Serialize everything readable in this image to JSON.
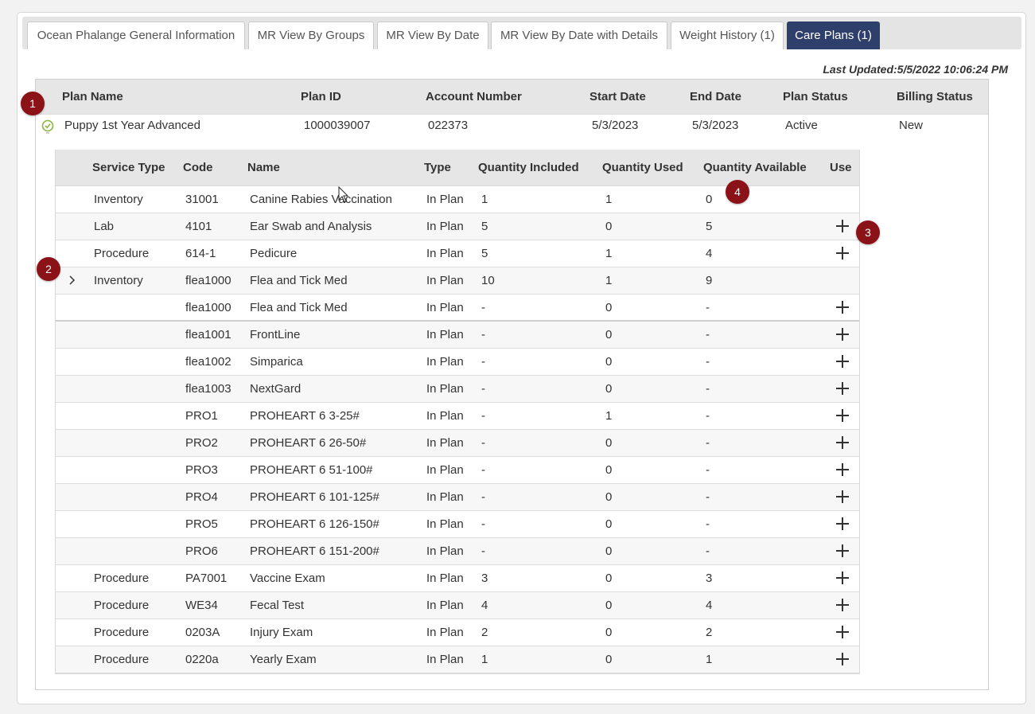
{
  "tabs": [
    {
      "label": "Ocean Phalange General Information",
      "active": false
    },
    {
      "label": "MR View By Groups",
      "active": false
    },
    {
      "label": "MR View By Date",
      "active": false
    },
    {
      "label": "MR View By Date with Details",
      "active": false
    },
    {
      "label": "Weight History (1)",
      "active": false
    },
    {
      "label": "Care Plans (1)",
      "active": true
    }
  ],
  "last_updated": "Last Updated:5/5/2022 10:06:24 PM",
  "plan_table": {
    "headers": [
      "Plan Name",
      "Plan ID",
      "Account Number",
      "Start Date",
      "End Date",
      "Plan Status",
      "Billing Status"
    ],
    "row": {
      "plan_name": "Puppy 1st Year Advanced",
      "plan_id": "1000039007",
      "account_number": "022373",
      "start_date": "5/3/2023",
      "end_date": "5/3/2023",
      "plan_status": "Active",
      "billing_status": "New"
    }
  },
  "service_table": {
    "headers": [
      "Service Type",
      "Code",
      "Name",
      "Type",
      "Quantity Included",
      "Quantity Used",
      "Quantity Available",
      "Use"
    ],
    "rows": [
      {
        "service_type": "Inventory",
        "code": "31001",
        "name": "Canine Rabies Vaccination",
        "type": "In Plan",
        "qty_included": "1",
        "qty_used": "1",
        "qty_available": "0",
        "use": false
      },
      {
        "service_type": "Lab",
        "code": "4101",
        "name": "Ear Swab and Analysis",
        "type": "In Plan",
        "qty_included": "5",
        "qty_used": "0",
        "qty_available": "5",
        "use": true
      },
      {
        "service_type": "Procedure",
        "code": "614-1",
        "name": "Pedicure",
        "type": "In Plan",
        "qty_included": "5",
        "qty_used": "1",
        "qty_available": "4",
        "use": true
      },
      {
        "service_type": "Inventory",
        "code": "flea1000",
        "name": "Flea and Tick Med",
        "type": "In Plan",
        "qty_included": "10",
        "qty_used": "1",
        "qty_available": "9",
        "use": false,
        "expandable": true
      },
      {
        "service_type": "",
        "code": "flea1000",
        "name": "Flea and Tick Med",
        "type": "In Plan",
        "qty_included": "-",
        "qty_used": "0",
        "qty_available": "-",
        "use": true
      },
      {
        "service_type": "",
        "code": "flea1001",
        "name": "FrontLine",
        "type": "In Plan",
        "qty_included": "-",
        "qty_used": "0",
        "qty_available": "-",
        "use": true
      },
      {
        "service_type": "",
        "code": "flea1002",
        "name": "Simparica",
        "type": "In Plan",
        "qty_included": "-",
        "qty_used": "0",
        "qty_available": "-",
        "use": true
      },
      {
        "service_type": "",
        "code": "flea1003",
        "name": "NextGard",
        "type": "In Plan",
        "qty_included": "-",
        "qty_used": "0",
        "qty_available": "-",
        "use": true
      },
      {
        "service_type": "",
        "code": "PRO1",
        "name": "PROHEART 6 3-25#",
        "type": "In Plan",
        "qty_included": "-",
        "qty_used": "1",
        "qty_available": "-",
        "use": true
      },
      {
        "service_type": "",
        "code": "PRO2",
        "name": "PROHEART 6 26-50#",
        "type": "In Plan",
        "qty_included": "-",
        "qty_used": "0",
        "qty_available": "-",
        "use": true
      },
      {
        "service_type": "",
        "code": "PRO3",
        "name": "PROHEART 6 51-100#",
        "type": "In Plan",
        "qty_included": "-",
        "qty_used": "0",
        "qty_available": "-",
        "use": true
      },
      {
        "service_type": "",
        "code": "PRO4",
        "name": "PROHEART 6 101-125#",
        "type": "In Plan",
        "qty_included": "-",
        "qty_used": "0",
        "qty_available": "-",
        "use": true
      },
      {
        "service_type": "",
        "code": "PRO5",
        "name": "PROHEART 6 126-150#",
        "type": "In Plan",
        "qty_included": "-",
        "qty_used": "0",
        "qty_available": "-",
        "use": true
      },
      {
        "service_type": "",
        "code": "PRO6",
        "name": "PROHEART 6 151-200#",
        "type": "In Plan",
        "qty_included": "-",
        "qty_used": "0",
        "qty_available": "-",
        "use": true
      },
      {
        "service_type": "Procedure",
        "code": "PA7001",
        "name": "Vaccine Exam",
        "type": "In Plan",
        "qty_included": "3",
        "qty_used": "0",
        "qty_available": "3",
        "use": true
      },
      {
        "service_type": "Procedure",
        "code": "WE34",
        "name": "Fecal Test",
        "type": "In Plan",
        "qty_included": "4",
        "qty_used": "0",
        "qty_available": "4",
        "use": true
      },
      {
        "service_type": "Procedure",
        "code": "0203A",
        "name": "Injury Exam",
        "type": "In Plan",
        "qty_included": "2",
        "qty_used": "0",
        "qty_available": "2",
        "use": true
      },
      {
        "service_type": "Procedure",
        "code": "0220a",
        "name": "Yearly Exam",
        "type": "In Plan",
        "qty_included": "1",
        "qty_used": "0",
        "qty_available": "1",
        "use": true
      }
    ]
  },
  "markers": [
    "1",
    "2",
    "3",
    "4"
  ],
  "icons": {
    "plan_check": "check-circle-icon",
    "expand": "chevron-right-icon",
    "use": "plus-icon"
  },
  "colors": {
    "active_tab": "#2f3f6b",
    "marker": "#8b1216",
    "check": "#8ab43c"
  }
}
